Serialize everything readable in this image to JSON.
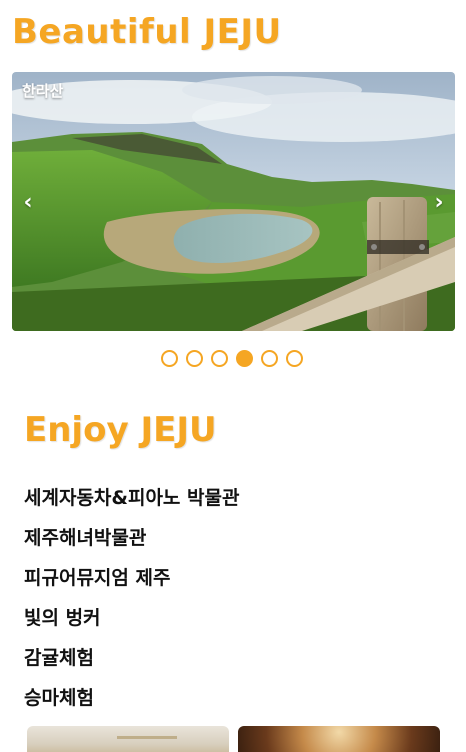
{
  "header": {
    "title": "Beautiful JEJU"
  },
  "carousel": {
    "caption": "한라산",
    "prev_label": "‹",
    "next_label": "›",
    "slide_count": 6,
    "active_index": 3
  },
  "section": {
    "title": "Enjoy JEJU"
  },
  "menu": {
    "items": [
      {
        "label": "세계자동차&피아노 박물관"
      },
      {
        "label": "제주해녀박물관"
      },
      {
        "label": "피규어뮤지엄 제주"
      },
      {
        "label": "빛의 벙커"
      },
      {
        "label": "감귤체험"
      },
      {
        "label": "승마체험"
      }
    ]
  },
  "colors": {
    "accent": "#f5a623",
    "text": "#111111"
  }
}
